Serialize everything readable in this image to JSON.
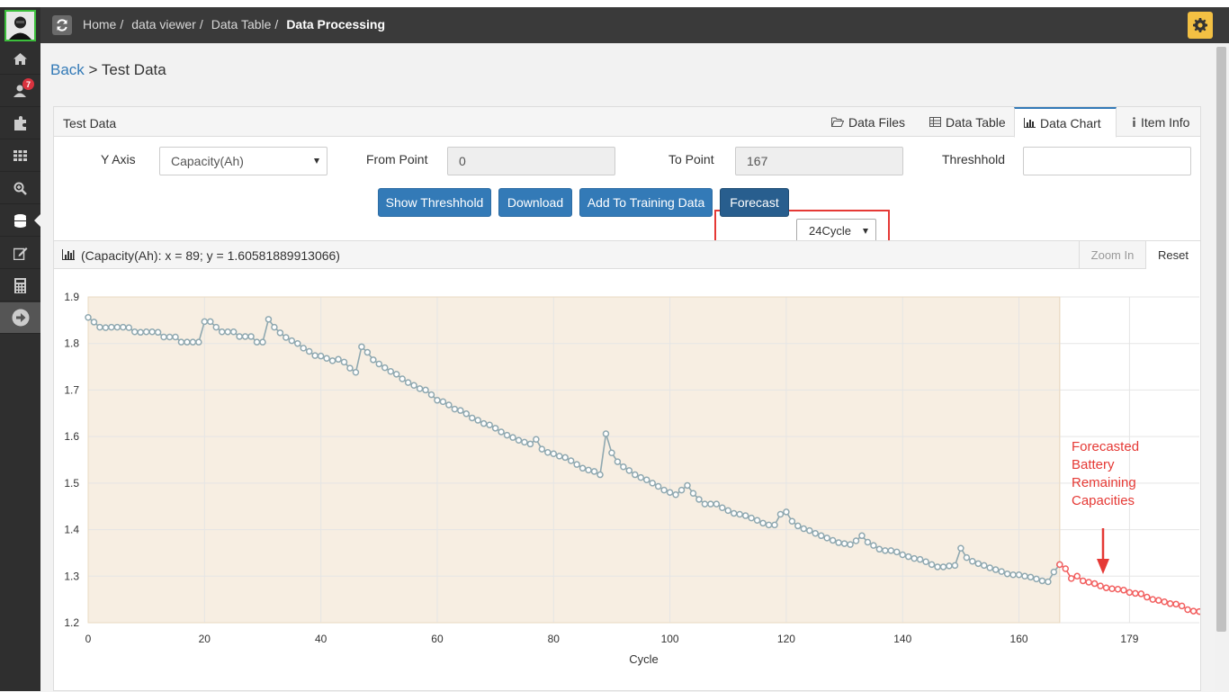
{
  "breadcrumb": {
    "items": [
      "Home",
      "data viewer",
      "Data Table"
    ],
    "current": "Data Processing"
  },
  "sidebar": {
    "badge": "7",
    "items": [
      "home-icon",
      "users-icon",
      "puzzle-icon",
      "grid-icon",
      "search-zoom-icon",
      "database-icon",
      "edit-icon",
      "calculator-icon",
      "arrow-right-icon"
    ]
  },
  "page": {
    "back_label": "Back",
    "separator": ">",
    "title": "Test Data"
  },
  "panel": {
    "title": "Test Data",
    "tabs": [
      {
        "label": "Data Files",
        "icon": "folder-open-icon"
      },
      {
        "label": "Data Table",
        "icon": "table-icon"
      },
      {
        "label": "Data Chart",
        "icon": "bar-chart-icon",
        "active": true
      },
      {
        "label": "Item Info",
        "icon": "info-icon"
      }
    ]
  },
  "form": {
    "y_axis_label": "Y Axis",
    "y_axis_value": "Capacity(Ah)",
    "from_point_label": "From Point",
    "from_point_value": "0",
    "to_point_label": "To Point",
    "to_point_value": "167",
    "threshold_label": "Threshhold",
    "threshold_value": ""
  },
  "actions": {
    "show_threshold": "Show Threshhold",
    "download": "Download",
    "add_training": "Add To Training Data",
    "forecast": "Forecast",
    "cycle_select": "24Cycle"
  },
  "chart_header": {
    "info": "(Capacity(Ah): x = 89; y = 1.60581889913066)",
    "zoom_in": "Zoom In",
    "reset": "Reset"
  },
  "colors": {
    "accent": "#337ab7",
    "measured": "#8fa8b0",
    "forecast": "#f26060",
    "region": "#f7eee2",
    "annotation": "#e53935"
  },
  "annotation": {
    "lines": [
      "Forecasted",
      "Battery",
      "Remaining",
      "Capacities"
    ]
  },
  "chart_data": {
    "type": "line",
    "xlabel": "Cycle",
    "ylabel": "",
    "xlim": [
      0,
      191
    ],
    "ylim": [
      1.2,
      1.9
    ],
    "x_ticks": [
      0,
      20,
      40,
      60,
      80,
      100,
      120,
      140,
      160,
      179
    ],
    "y_ticks": [
      1.2,
      1.3,
      1.4,
      1.5,
      1.6,
      1.7,
      1.8,
      1.9
    ],
    "highlight_x_range": [
      0,
      167
    ],
    "series": [
      {
        "id": "measured",
        "x_start": 0,
        "values": [
          1.856,
          1.846,
          1.835,
          1.834,
          1.835,
          1.835,
          1.835,
          1.834,
          1.825,
          1.824,
          1.825,
          1.825,
          1.824,
          1.814,
          1.814,
          1.814,
          1.803,
          1.803,
          1.803,
          1.803,
          1.847,
          1.847,
          1.835,
          1.825,
          1.825,
          1.825,
          1.815,
          1.815,
          1.815,
          1.803,
          1.803,
          1.852,
          1.835,
          1.823,
          1.813,
          1.806,
          1.8,
          1.79,
          1.783,
          1.774,
          1.773,
          1.768,
          1.763,
          1.766,
          1.76,
          1.747,
          1.738,
          1.793,
          1.781,
          1.765,
          1.756,
          1.748,
          1.74,
          1.734,
          1.724,
          1.716,
          1.71,
          1.703,
          1.7,
          1.69,
          1.678,
          1.675,
          1.668,
          1.659,
          1.656,
          1.649,
          1.64,
          1.635,
          1.628,
          1.625,
          1.618,
          1.61,
          1.603,
          1.598,
          1.592,
          1.588,
          1.584,
          1.594,
          1.573,
          1.566,
          1.563,
          1.558,
          1.555,
          1.548,
          1.54,
          1.532,
          1.528,
          1.525,
          1.518,
          1.606,
          1.565,
          1.546,
          1.535,
          1.527,
          1.518,
          1.512,
          1.507,
          1.5,
          1.493,
          1.485,
          1.48,
          1.475,
          1.485,
          1.495,
          1.478,
          1.465,
          1.455,
          1.455,
          1.455,
          1.447,
          1.441,
          1.435,
          1.433,
          1.43,
          1.425,
          1.42,
          1.414,
          1.41,
          1.41,
          1.433,
          1.438,
          1.418,
          1.408,
          1.402,
          1.398,
          1.392,
          1.387,
          1.382,
          1.377,
          1.372,
          1.37,
          1.368,
          1.376,
          1.387,
          1.373,
          1.366,
          1.358,
          1.355,
          1.355,
          1.352,
          1.346,
          1.342,
          1.338,
          1.336,
          1.331,
          1.325,
          1.32,
          1.32,
          1.322,
          1.323,
          1.36,
          1.34,
          1.332,
          1.327,
          1.323,
          1.318,
          1.314,
          1.31,
          1.305,
          1.303,
          1.303,
          1.3,
          1.298,
          1.294,
          1.29,
          1.288,
          1.309,
          1.325
        ]
      },
      {
        "id": "forecast",
        "x_start": 167,
        "values": [
          1.325,
          1.316,
          1.295,
          1.3,
          1.29,
          1.287,
          1.284,
          1.279,
          1.275,
          1.273,
          1.272,
          1.27,
          1.265,
          1.263,
          1.262,
          1.255,
          1.25,
          1.248,
          1.245,
          1.241,
          1.24,
          1.236,
          1.228,
          1.225,
          1.224,
          1.22
        ]
      }
    ]
  }
}
